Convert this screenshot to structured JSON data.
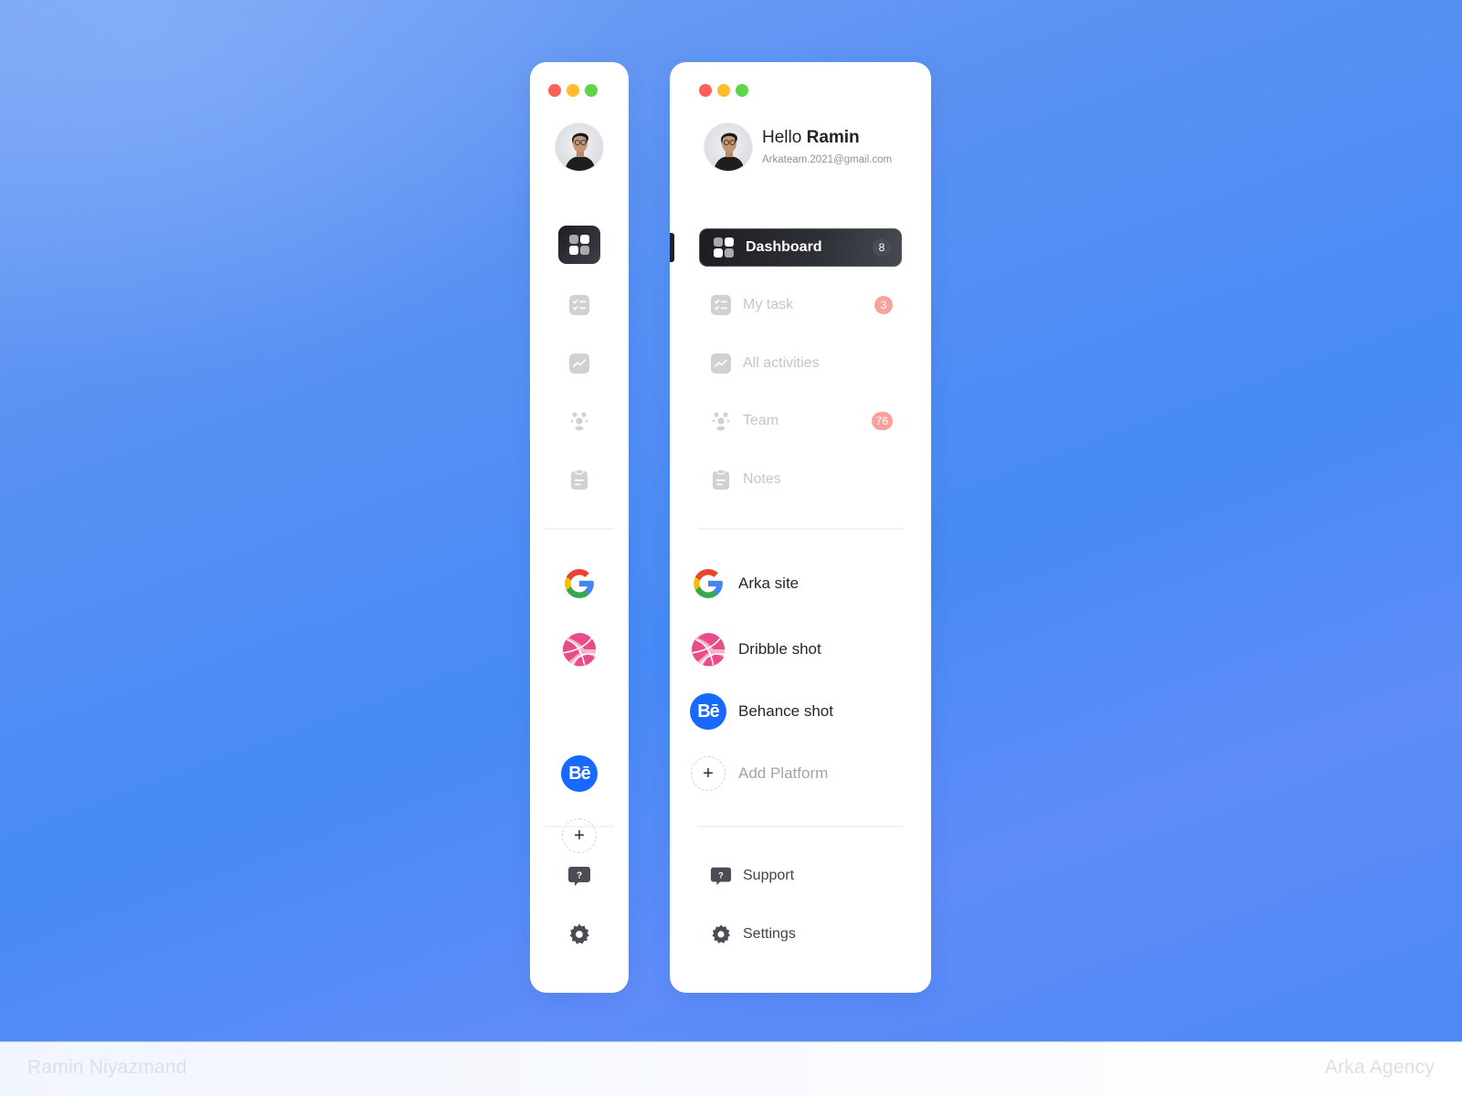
{
  "footer": {
    "left_credit": "Ramin Niyazmand",
    "right_credit": "Arka Agency"
  },
  "window_controls": [
    "close",
    "minimize",
    "maximize"
  ],
  "colors": {
    "close": "#fe5f57",
    "minimize": "#febc2e",
    "maximize": "#5fd64a",
    "active_bg": "#1c1e23",
    "badge_pink": "#f9a29a",
    "behance_blue": "#1769ff"
  },
  "user": {
    "greeting": "Hello",
    "name": "Ramin",
    "email": "Arkateam.2021@gmail.com"
  },
  "nav": {
    "items": [
      {
        "label": "Dashboard",
        "icon": "grid-icon",
        "badge": "8",
        "active": true
      },
      {
        "label": "My task",
        "icon": "checklist-icon",
        "badge": "3",
        "active": false
      },
      {
        "label": "All activities",
        "icon": "activity-chart-icon",
        "badge": null,
        "active": false
      },
      {
        "label": "Team",
        "icon": "team-icon",
        "badge": "76",
        "active": false
      },
      {
        "label": "Notes",
        "icon": "clipboard-icon",
        "badge": null,
        "active": false
      }
    ]
  },
  "platforms": {
    "items": [
      {
        "label": "Arka site",
        "icon": "google-icon"
      },
      {
        "label": "Dribble shot",
        "icon": "dribbble-icon"
      },
      {
        "label": "Behance shot",
        "icon": "behance-icon",
        "glyph": "Bē"
      },
      {
        "label": "Add Platform",
        "icon": "plus-icon",
        "glyph": "+"
      }
    ]
  },
  "bottom": {
    "items": [
      {
        "label": "Support",
        "icon": "support-chat-icon"
      },
      {
        "label": "Settings",
        "icon": "gear-icon"
      }
    ]
  }
}
